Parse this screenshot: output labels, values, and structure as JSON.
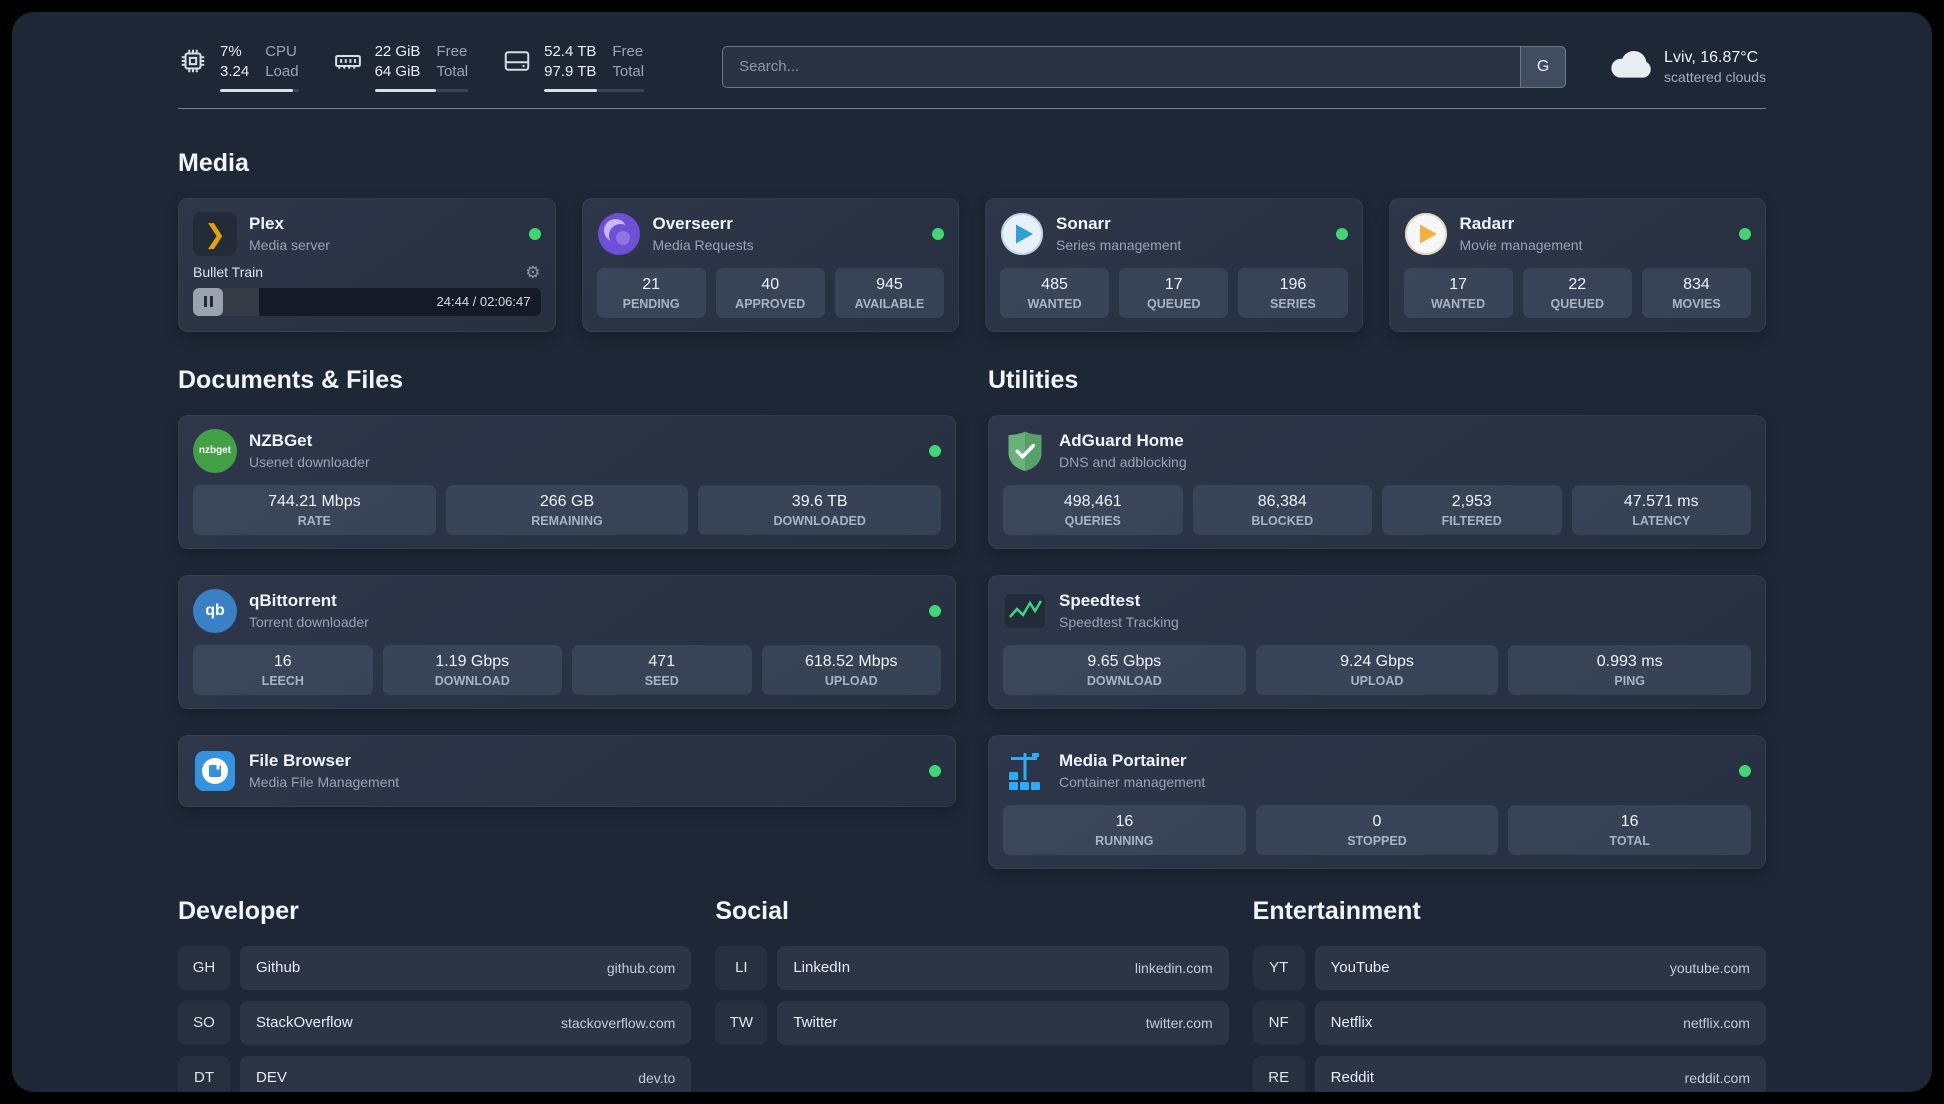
{
  "colors": {
    "background": "#1e2736",
    "status_online": "#3fd673",
    "plex": "#e5a00d",
    "overseerr": "#6d4fd8",
    "sonarr": "#2f9fd8",
    "radarr": "#f2b33c",
    "nzbget": "#43a047",
    "qbittorrent": "#3a80c4",
    "adguard": "#67b279",
    "speedtest": "#3fd97c",
    "portainer": "#29aef5",
    "filebrowser": "#3493e0"
  },
  "icons": {
    "gear": "⚙",
    "plex_chevron": "❯",
    "qbittorrent_text": "qb",
    "nzbget_text": "nzbget"
  },
  "topbar": {
    "cpu": {
      "value1": "7%",
      "value2": "3.24",
      "label1": "CPU",
      "label2": "Load",
      "bar_percent": 93
    },
    "ram": {
      "value1": "22 GiB",
      "value2": "64 GiB",
      "label1": "Free",
      "label2": "Total",
      "bar_percent": 66
    },
    "disk": {
      "value1": "52.4 TB",
      "value2": "97.9 TB",
      "label1": "Free",
      "label2": "Total",
      "bar_percent": 53
    },
    "search": {
      "placeholder": "Search...",
      "button": "G"
    },
    "weather": {
      "location": "Lviv, 16.87°C",
      "condition": "scattered clouds"
    }
  },
  "sections": {
    "media": {
      "title": "Media"
    },
    "documents": {
      "title": "Documents & Files"
    },
    "utilities": {
      "title": "Utilities"
    }
  },
  "services": {
    "plex": {
      "name": "Plex",
      "subtitle": "Media server",
      "player": {
        "track": "Bullet Train",
        "time": "24:44 / 02:06:47",
        "progress_percent": 19
      }
    },
    "overseerr": {
      "name": "Overseerr",
      "subtitle": "Media Requests",
      "stats": [
        {
          "value": "21",
          "label": "PENDING"
        },
        {
          "value": "40",
          "label": "APPROVED"
        },
        {
          "value": "945",
          "label": "AVAILABLE"
        }
      ]
    },
    "sonarr": {
      "name": "Sonarr",
      "subtitle": "Series management",
      "stats": [
        {
          "value": "485",
          "label": "WANTED"
        },
        {
          "value": "17",
          "label": "QUEUED"
        },
        {
          "value": "196",
          "label": "SERIES"
        }
      ]
    },
    "radarr": {
      "name": "Radarr",
      "subtitle": "Movie management",
      "stats": [
        {
          "value": "17",
          "label": "WANTED"
        },
        {
          "value": "22",
          "label": "QUEUED"
        },
        {
          "value": "834",
          "label": "MOVIES"
        }
      ]
    },
    "nzbget": {
      "name": "NZBGet",
      "subtitle": "Usenet downloader",
      "stats": [
        {
          "value": "744.21 Mbps",
          "label": "RATE"
        },
        {
          "value": "266 GB",
          "label": "REMAINING"
        },
        {
          "value": "39.6 TB",
          "label": "DOWNLOADED"
        }
      ]
    },
    "qbittorrent": {
      "name": "qBittorrent",
      "subtitle": "Torrent downloader",
      "stats": [
        {
          "value": "16",
          "label": "LEECH"
        },
        {
          "value": "1.19 Gbps",
          "label": "DOWNLOAD"
        },
        {
          "value": "471",
          "label": "SEED"
        },
        {
          "value": "618.52 Mbps",
          "label": "UPLOAD"
        }
      ]
    },
    "filebrowser": {
      "name": "File Browser",
      "subtitle": "Media File Management"
    },
    "adguard": {
      "name": "AdGuard Home",
      "subtitle": "DNS and adblocking",
      "stats": [
        {
          "value": "498,461",
          "label": "QUERIES"
        },
        {
          "value": "86,384",
          "label": "BLOCKED"
        },
        {
          "value": "2,953",
          "label": "FILTERED"
        },
        {
          "value": "47.571 ms",
          "label": "LATENCY"
        }
      ]
    },
    "speedtest": {
      "name": "Speedtest",
      "subtitle": "Speedtest Tracking",
      "stats": [
        {
          "value": "9.65 Gbps",
          "label": "DOWNLOAD"
        },
        {
          "value": "9.24 Gbps",
          "label": "UPLOAD"
        },
        {
          "value": "0.993 ms",
          "label": "PING"
        }
      ]
    },
    "portainer": {
      "name": "Media Portainer",
      "subtitle": "Container management",
      "stats": [
        {
          "value": "16",
          "label": "RUNNING"
        },
        {
          "value": "0",
          "label": "STOPPED"
        },
        {
          "value": "16",
          "label": "TOTAL"
        }
      ]
    }
  },
  "bookmarks": {
    "developer": {
      "title": "Developer",
      "items": [
        {
          "abbr": "GH",
          "name": "Github",
          "url": "github.com"
        },
        {
          "abbr": "SO",
          "name": "StackOverflow",
          "url": "stackoverflow.com"
        },
        {
          "abbr": "DT",
          "name": "DEV",
          "url": "dev.to"
        }
      ]
    },
    "social": {
      "title": "Social",
      "items": [
        {
          "abbr": "LI",
          "name": "LinkedIn",
          "url": "linkedin.com"
        },
        {
          "abbr": "TW",
          "name": "Twitter",
          "url": "twitter.com"
        }
      ]
    },
    "entertainment": {
      "title": "Entertainment",
      "items": [
        {
          "abbr": "YT",
          "name": "YouTube",
          "url": "youtube.com"
        },
        {
          "abbr": "NF",
          "name": "Netflix",
          "url": "netflix.com"
        },
        {
          "abbr": "RE",
          "name": "Reddit",
          "url": "reddit.com"
        }
      ]
    }
  }
}
